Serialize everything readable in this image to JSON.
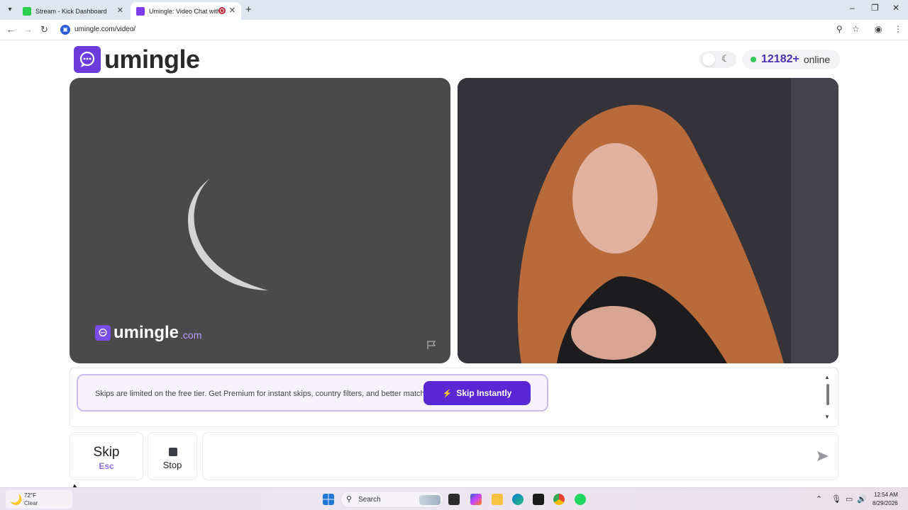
{
  "browser": {
    "tabs": [
      {
        "title": "Stream - Kick Dashboard",
        "active": false
      },
      {
        "title": "Umingle: Video Chat with St",
        "active": true,
        "recording": true
      }
    ],
    "new_tab_icon": "plus-icon",
    "window_controls": {
      "minimize": "–",
      "restore": "❐",
      "close": "✕"
    },
    "url": "umingle.com/video/"
  },
  "page": {
    "logo_text": "umingle",
    "online_count": "12182+",
    "online_label": "online",
    "theme_icon": "moon-icon",
    "watermark": {
      "brand": "umingle",
      "domain": ".com"
    },
    "promo_text": "Skips are limited on the free tier. Get Premium for instant skips, country filters, and better matches.",
    "skip_instantly_label": "Skip Instantly",
    "skip_label": "Skip",
    "skip_key": "Esc",
    "stop_label": "Stop",
    "message_placeholder": ""
  },
  "taskbar": {
    "weather_temp": "72°F",
    "weather_cond": "Clear",
    "search_label": "Search",
    "time": "12:54 AM",
    "date": "8/29/2026"
  },
  "colors": {
    "brand_purple": "#5b26d4",
    "online_count": "#4a2fb0",
    "online_dot": "#34c759",
    "promo_border": "#cbb9f4",
    "skip_key": "#8f6de6"
  }
}
